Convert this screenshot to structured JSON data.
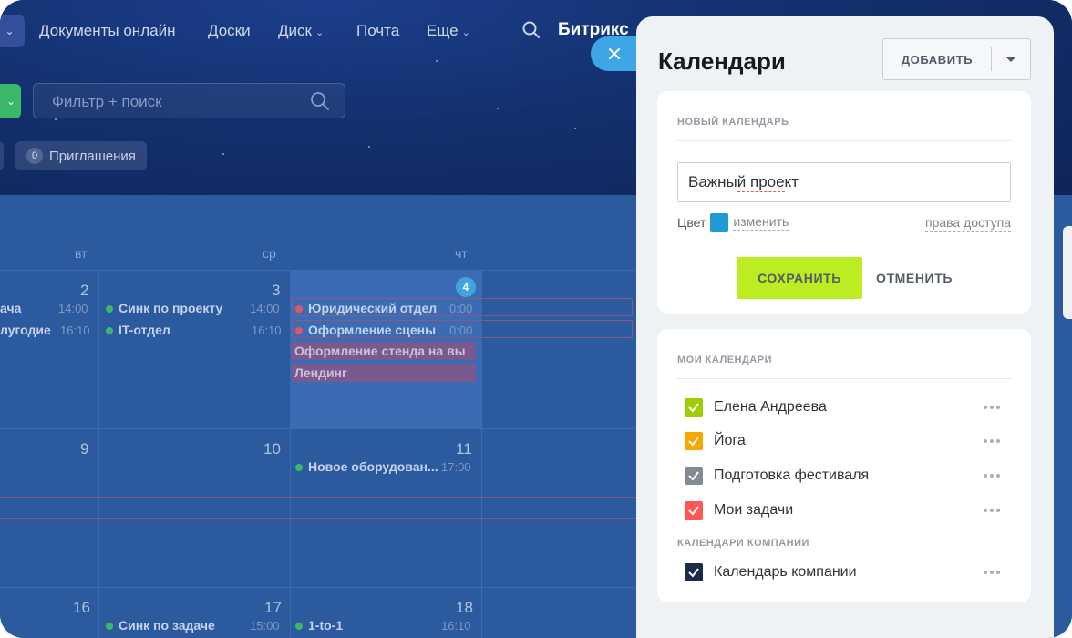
{
  "background": {
    "nav": {
      "items": [
        "Документы онлайн",
        "Доски",
        "Диск",
        "Почта",
        "Еще"
      ],
      "brand": "Битрикс"
    },
    "filter": {
      "placeholder": "Фильтр + поиск"
    },
    "invitations": {
      "count": "0",
      "label": "Приглашения"
    },
    "weekdays": {
      "tue": "вт",
      "wed": "ср",
      "thu": "чт"
    },
    "days": [
      "2",
      "3",
      "4",
      "9",
      "10",
      "11",
      "16",
      "17",
      "18"
    ],
    "events": {
      "e1": "ача",
      "e1t": "14:00",
      "e2": "лугодие",
      "e2t": "16:10",
      "e3": "Синк по проекту",
      "e3t": "14:00",
      "e4": "IT-отдел",
      "e4t": "16:10",
      "e5": "Юридический отдел",
      "e5t": "0:00",
      "e6": "Оформление сцены",
      "e6t": "0:00",
      "e7": "Оформление стенда на вы",
      "e8": "Лендинг",
      "e9": "Новое оборудован...",
      "e9t": "17:00",
      "e10": "Синк по задаче",
      "e10t": "15:00",
      "e11": "1-to-1",
      "e11t": "16:10"
    }
  },
  "panel": {
    "title": "Календари",
    "add_label": "ДОБАВИТЬ",
    "new_calendar": {
      "header": "НОВЫЙ КАЛЕНДАРЬ",
      "name_value": "Важный проект",
      "color_label": "Цвет",
      "color": "#1e9ad6",
      "change_link": "изменить",
      "access_link": "права доступа",
      "save": "СОХРАНИТЬ",
      "cancel": "ОТМЕНИТЬ"
    },
    "my_calendars": {
      "header": "МОИ КАЛЕНДАРИ",
      "items": [
        {
          "label": "Елена Андреева",
          "color": "#9dcf00"
        },
        {
          "label": "Йога",
          "color": "#f7a700"
        },
        {
          "label": "Подготовка фестиваля",
          "color": "#828b95"
        },
        {
          "label": "Мои задачи",
          "color": "#ff5752"
        }
      ]
    },
    "company_calendars": {
      "header": "КАЛЕНДАРИ КОМПАНИИ",
      "items": [
        {
          "label": "Календарь компании",
          "color": "#1c2b4b"
        }
      ]
    }
  }
}
